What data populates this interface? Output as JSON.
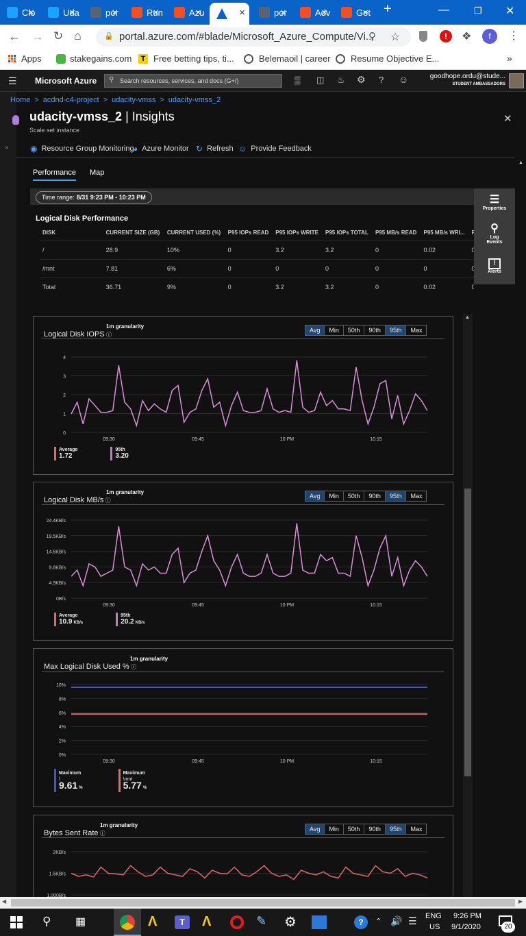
{
  "browser": {
    "tabs": [
      {
        "label": "Clo",
        "color": "#1aa3ff"
      },
      {
        "label": "Uda",
        "color": "#1aa3ff"
      },
      {
        "label": "por",
        "color": "#5a6470"
      },
      {
        "label": "Run",
        "color": "#f25022"
      },
      {
        "label": "Azu",
        "color": "#f25022"
      },
      {
        "label": "",
        "color": "#0a63c9"
      },
      {
        "label": "por",
        "color": "#5a6470"
      },
      {
        "label": "Adv",
        "color": "#f25022"
      },
      {
        "label": "Get",
        "color": "#f25022"
      }
    ],
    "new_tab": "+",
    "url": "portal.azure.com/#blade/Microsoft_Azure_Compute/Vi...",
    "profile_letter": "f",
    "bookmarks": [
      {
        "label": "Apps"
      },
      {
        "label": "stakegains.com"
      },
      {
        "label": "Free betting tips, ti..."
      },
      {
        "label": "Belemaoil | career"
      },
      {
        "label": "Resume Objective E..."
      }
    ]
  },
  "azure": {
    "brand": "Microsoft Azure",
    "search_placeholder": "Search resources, services, and docs (G+/)",
    "user_name": "goodhope.ordu@stude...",
    "user_role": "STUDENT AMBASSADORS"
  },
  "breadcrumb": [
    "Home",
    "acdnd-c4-project",
    "udacity-vmss",
    "udacity-vmss_2"
  ],
  "blade": {
    "title_main": "udacity-vmss_2",
    "title_sep": " | ",
    "title_sub": "Insights",
    "subtitle": "Scale set instance"
  },
  "commands": [
    "Resource Group Monitoring",
    "Azure Monitor",
    "Refresh",
    "Provide Feedback"
  ],
  "tabs": [
    "Performance",
    "Map"
  ],
  "time_range": {
    "label": "Time range:",
    "value": "8/31 9:23 PM - 10:23 PM"
  },
  "right_panel": [
    "Properties",
    "Log Events",
    "Alerts"
  ],
  "disk_table": {
    "title": "Logical Disk Performance",
    "headers": [
      "DISK",
      "CURRENT SIZE (GB)",
      "CURRENT USED (%)",
      "P95 IOPs READ",
      "P95 IOPs WRITE",
      "P95 IOPs TOTAL",
      "P95 MB/s READ",
      "P95 MB/s WRI...",
      "P95 MB/s TOT"
    ],
    "rows": [
      [
        "/",
        "28.9",
        "10%",
        "0",
        "3.2",
        "3.2",
        "0",
        "0.02",
        "0.02"
      ],
      [
        "/mnt",
        "7.81",
        "6%",
        "0",
        "0",
        "0",
        "0",
        "0",
        "0"
      ],
      [
        "Total",
        "36.71",
        "9%",
        "0",
        "3.2",
        "3.2",
        "0",
        "0.02",
        "0.02"
      ]
    ]
  },
  "segments": [
    "Avg",
    "Min",
    "50th",
    "90th",
    "95th",
    "Max"
  ],
  "granularity": "1m granularity",
  "charts": [
    {
      "title": "Logical Disk IOPS",
      "yticks": [
        "4",
        "3",
        "2",
        "1",
        "0"
      ],
      "xticks": [
        "09:30",
        "09:45",
        "10 PM",
        "10:15"
      ],
      "legend": [
        {
          "label": "Average",
          "value": "1.72",
          "unit": "",
          "color": "#e06a6a"
        },
        {
          "label": "95th",
          "value": "3.20",
          "unit": "",
          "color": "#c27fc0"
        }
      ]
    },
    {
      "title": "Logical Disk MB/s",
      "yticks": [
        "24.4KB/s",
        "19.5KB/s",
        "14.6KB/s",
        "9.8KB/s",
        "4.9KB/s",
        "0B/s"
      ],
      "xticks": [
        "09:30",
        "09:45",
        "10 PM",
        "10:15"
      ],
      "legend": [
        {
          "label": "Average",
          "value": "10.9",
          "unit": "KB/s",
          "color": "#e06a6a"
        },
        {
          "label": "95th",
          "value": "20.2",
          "unit": "KB/s",
          "color": "#c27fc0"
        }
      ]
    },
    {
      "title": "Max Logical Disk Used %",
      "yticks": [
        "10%",
        "8%",
        "6%",
        "4%",
        "2%",
        "0%"
      ],
      "xticks": [
        "09:30",
        "09:45",
        "10 PM",
        "10:15"
      ],
      "legend": [
        {
          "label": "Maximum",
          "sub": "\\",
          "value": "9.61",
          "unit": "%",
          "color": "#3a56d4"
        },
        {
          "label": "Maximum",
          "sub": "\\mnt",
          "value": "5.77",
          "unit": "%",
          "color": "#e06a6a"
        }
      ]
    },
    {
      "title": "Bytes Sent Rate",
      "yticks": [
        "2KB/s",
        "1.5KB/s",
        "1,000B/s"
      ],
      "xticks": [],
      "legend": []
    }
  ],
  "chart_data": [
    {
      "type": "line",
      "title": "Logical Disk IOPS",
      "ylim": [
        0,
        4.5
      ],
      "series": [
        {
          "name": "95th",
          "color": "#d98fd6",
          "values": [
            1.1,
            1.8,
            0.5,
            2.0,
            1.6,
            1.2,
            1.2,
            1.3,
            4.0,
            1.8,
            1.4,
            0.4,
            1.9,
            1.3,
            1.7,
            1.4,
            1.2,
            2.5,
            2.8,
            0.6,
            1.2,
            1.4,
            2.5,
            3.2,
            1.5,
            1.8,
            0.4,
            1.6,
            2.4,
            1.3,
            1.2,
            1.2,
            1.3,
            2.6,
            1.4,
            1.2,
            1.3,
            1.2,
            4.3,
            1.5,
            1.2,
            1.3,
            2.4,
            1.6,
            1.9,
            1.4,
            1.4,
            1.3,
            3.9,
            1.9,
            0.5,
            1.5,
            2.9,
            3.1,
            0.8,
            2.2,
            0.5,
            1.3,
            2.3,
            1.9,
            1.3
          ]
        }
      ]
    },
    {
      "type": "line",
      "title": "Logical Disk MB/s",
      "ylim": [
        0,
        25
      ],
      "series": [
        {
          "name": "95th",
          "color": "#d98fd6",
          "values": [
            7,
            9,
            4,
            11,
            10,
            7,
            8,
            9,
            23,
            10,
            9,
            4,
            11,
            9,
            10,
            8,
            8,
            14,
            16,
            5,
            8,
            9,
            15,
            20,
            12,
            9,
            4,
            10,
            14,
            8,
            7,
            7,
            8,
            14,
            8,
            7,
            7,
            8,
            24,
            9,
            8,
            8,
            14,
            12,
            13,
            8,
            8,
            7,
            20,
            13,
            4,
            9,
            16,
            20,
            7,
            13,
            4,
            9,
            12,
            10,
            7
          ]
        }
      ]
    },
    {
      "type": "line",
      "title": "Max Logical Disk Used %",
      "ylim": [
        0,
        10
      ],
      "series": [
        {
          "name": "Maximum \\",
          "color": "#3a56d4",
          "values": [
            9.61,
            9.61,
            9.61,
            9.61,
            9.61,
            9.61,
            9.61,
            9.61,
            9.61,
            9.61,
            9.61,
            9.61,
            9.61
          ]
        },
        {
          "name": "Maximum \\mnt",
          "color": "#e06a6a",
          "values": [
            5.77,
            5.77,
            5.77,
            5.77,
            5.77,
            5.77,
            5.77,
            5.77,
            5.77,
            5.77,
            5.77,
            5.77,
            5.77
          ]
        }
      ]
    },
    {
      "type": "line",
      "title": "Bytes Sent Rate",
      "ylim": [
        1000,
        2400
      ],
      "series": [
        {
          "name": "Bytes Sent",
          "color": "#e06a6a",
          "values": [
            1700,
            1600,
            1650,
            1580,
            1900,
            1700,
            1680,
            1650,
            1950,
            1750,
            1600,
            1650,
            1900,
            1700,
            1650,
            1600,
            1850,
            1750,
            1550,
            1800,
            1700,
            1680,
            1900,
            1650,
            1600,
            1750,
            1950,
            1700,
            1600,
            1650,
            1500,
            1800,
            1700,
            1650,
            1750,
            1600,
            1550,
            1900,
            1700,
            1650,
            1600,
            1950,
            1750,
            1700,
            1850,
            1600,
            1700,
            1650,
            1550
          ]
        }
      ]
    }
  ],
  "taskbar": {
    "lang": "ENG",
    "region": "US",
    "time": "9:26 PM",
    "date": "9/1/2020",
    "notif": "20"
  }
}
